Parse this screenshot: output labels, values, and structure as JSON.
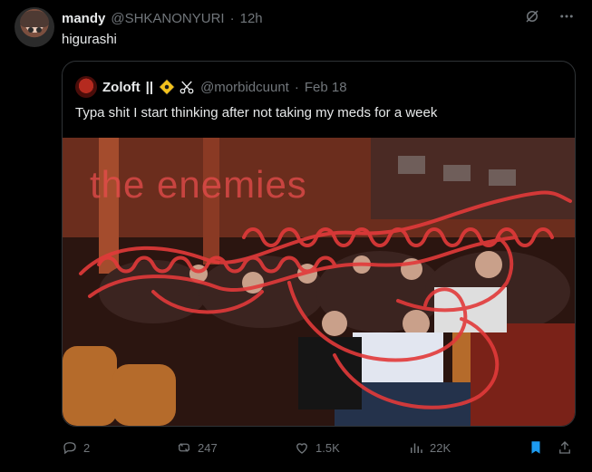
{
  "post": {
    "name": "mandy",
    "handle": "@SHKANONYURI",
    "sep": "·",
    "time": "12h",
    "text": "higurashi"
  },
  "header_icons": [
    "grok-icon",
    "more-icon"
  ],
  "quote": {
    "name": "Zoloft",
    "suffix": "||",
    "badges": [
      "warning-badge-icon",
      "scissors-icon"
    ],
    "handle": "@morbidcuunt",
    "sep": "·",
    "date": "Feb 18",
    "text": "Typa shit I start thinking after not taking my meds for a week",
    "media": {
      "overlay_text": "the enemies",
      "accent": "#e23a3a"
    }
  },
  "actions": {
    "replies": "2",
    "reposts": "247",
    "likes": "1.5K",
    "views": "22K"
  },
  "colors": {
    "background": "#000000",
    "text": "#e7e9ea",
    "muted": "#71767b",
    "border": "#2f3336",
    "accent": "#1d9bf0"
  }
}
